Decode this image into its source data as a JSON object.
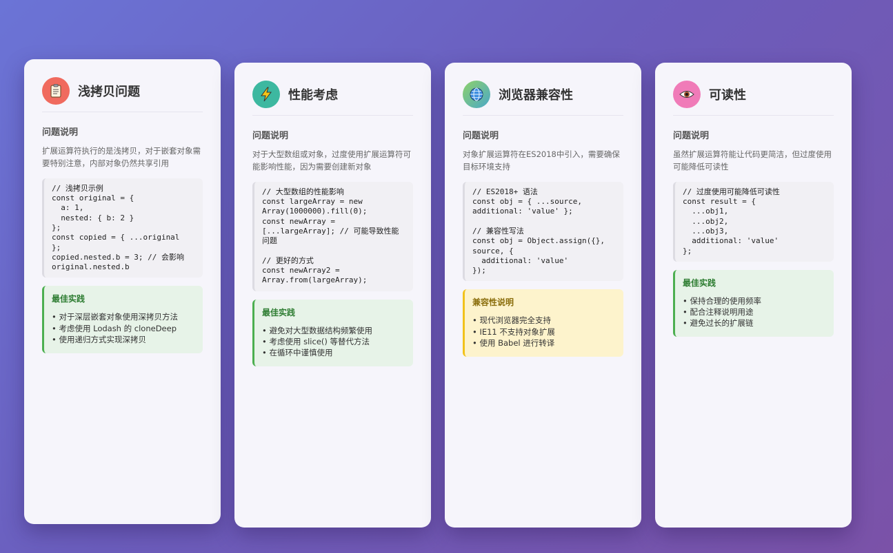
{
  "cards": [
    {
      "title": "浅拷贝问题",
      "icon": "clipboard-icon",
      "icon_bg": "#f06a5e",
      "section_title": "问题说明",
      "description": "扩展运算符执行的是浅拷贝，对于嵌套对象需要特别注意，内部对象仍然共享引用",
      "code": "// 浅拷贝示例\nconst original = {\n  a: 1,\n  nested: { b: 2 }\n};\nconst copied = { ...original\n};\ncopied.nested.b = 3; // 会影响\noriginal.nested.b",
      "practice_title": "最佳实践",
      "practice_items": [
        "对于深层嵌套对象使用深拷贝方法",
        "考虑使用 Lodash 的 cloneDeep",
        "使用递归方式实现深拷贝"
      ]
    },
    {
      "title": "性能考虑",
      "icon": "lightning-icon",
      "icon_bg": "#3db8a0",
      "section_title": "问题说明",
      "description": "对于大型数组或对象，过度使用扩展运算符可能影响性能，因为需要创建新对象",
      "code": "// 大型数组的性能影响\nconst largeArray = new\nArray(1000000).fill(0);\nconst newArray =\n[...largeArray]; // 可能导致性能问题\n\n// 更好的方式\nconst newArray2 =\nArray.from(largeArray);",
      "practice_title": "最佳实践",
      "practice_items": [
        "避免对大型数据结构频繁使用",
        "考虑使用 slice() 等替代方法",
        "在循环中谨慎使用"
      ]
    },
    {
      "title": "浏览器兼容性",
      "icon": "globe-icon",
      "icon_bg": "#6cc070",
      "section_title": "问题说明",
      "description": "对象扩展运算符在ES2018中引入，需要确保目标环境支持",
      "code": "// ES2018+ 语法\nconst obj = { ...source,\nadditional: 'value' };\n\n// 兼容性写法\nconst obj = Object.assign({},\nsource, {\n  additional: 'value'\n});",
      "practice_title": "兼容性说明",
      "practice_items": [
        "现代浏览器完全支持",
        "IE11 不支持对象扩展",
        "使用 Babel 进行转译"
      ]
    },
    {
      "title": "可读性",
      "icon": "eye-icon",
      "icon_bg": "#f07bb8",
      "section_title": "问题说明",
      "description": "虽然扩展运算符能让代码更简洁，但过度使用可能降低可读性",
      "code": "// 过度使用可能降低可读性\nconst result = {\n  ...obj1,\n  ...obj2,\n  ...obj3,\n  additional: 'value'\n};",
      "practice_title": "最佳实践",
      "practice_items": [
        "保持合理的使用频率",
        "配合注释说明用途",
        "避免过长的扩展链"
      ]
    }
  ]
}
